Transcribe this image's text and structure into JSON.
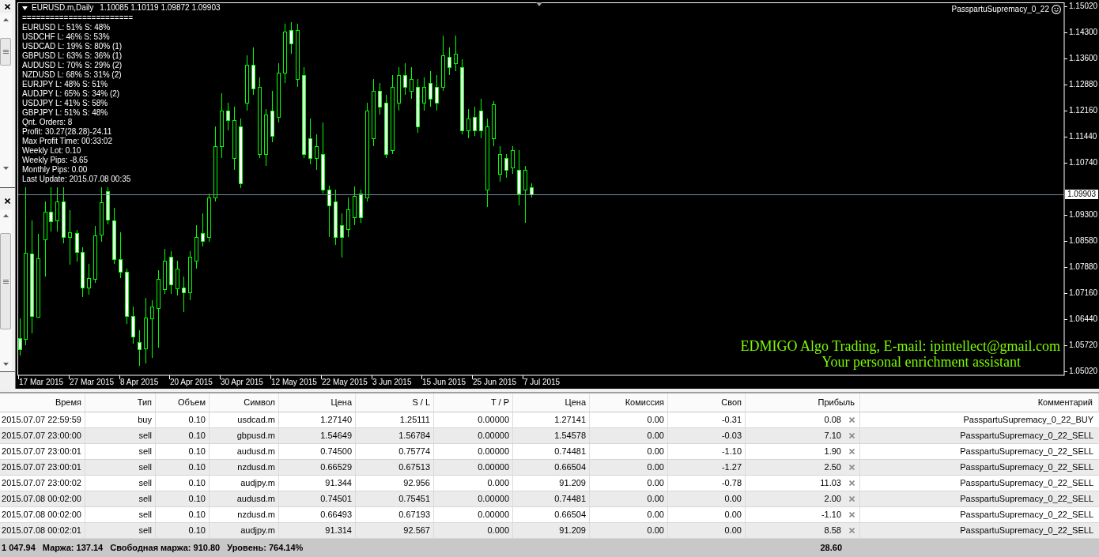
{
  "chart": {
    "title": "EURUSD.m,Daily",
    "ohlc": "1.10085 1.10119 1.09872 1.09903",
    "info_lines": [
      "========================",
      "EURUSD L: 51% S: 48%",
      "USDCHF L: 46% S: 53%",
      "USDCAD L: 19% S: 80% (1)",
      "GBPUSD L: 63% S: 36% (1)",
      "AUDUSD L: 70% S: 29% (2)",
      "NZDUSD L: 68% S: 31% (2)",
      "EURJPY L: 48% S: 51%",
      "AUDJPY L: 65% S: 34% (2)",
      "USDJPY L: 41% S: 58%",
      "GBPJPY L: 51% S: 48%",
      "Qnt. Orders: 8",
      "Profit: 30.27(28.28)-24.11",
      "Max Profit Time: 00:33:02",
      "Weekly Lot: 0.10",
      "Weekly Pips: -8.65",
      "Monthly Pips: 0.00",
      "Last Update: 2015.07.08 00:35"
    ],
    "expert_name": "PasspartuSupremacy_0_22",
    "banner_lines": [
      "EDMIGO Algo Trading, E-mail: ipintellect@gmail.com",
      "Your personal enrichment assistant"
    ],
    "price_labels": [
      "1.15020",
      "1.14300",
      "1.13600",
      "1.12880",
      "1.12160",
      "1.11440",
      "1.10740",
      "1.09300",
      "1.08580",
      "1.07880",
      "1.07160",
      "1.06440",
      "1.05720",
      "1.05020"
    ],
    "current_price": "1.09903",
    "date_labels": [
      "17 Mar 2015",
      "27 Mar 2015",
      "8 Apr 2015",
      "20 Apr 2015",
      "30 Apr 2015",
      "12 May 2015",
      "22 May 2015",
      "3 Jun 2015",
      "15 Jun 2015",
      "25 Jun 2015",
      "7 Jul 2015"
    ]
  },
  "orders_table": {
    "columns": [
      "Время",
      "Тип",
      "Объем",
      "Символ",
      "Цена",
      "S / L",
      "T / P",
      "Цена",
      "Комиссия",
      "Своп",
      "Прибыль",
      "Комментарий"
    ],
    "rows": [
      {
        "selected": false,
        "cells": [
          "2015.07.07 22:59:59",
          "buy",
          "0.10",
          "usdcad.m",
          "1.27140",
          "1.25111",
          "0.00000",
          "1.27141",
          "0.00",
          "-0.31",
          "0.08",
          "PasspartuSupremacy_0_22_BUY"
        ]
      },
      {
        "selected": false,
        "cells": [
          "2015.07.07 23:00:00",
          "sell",
          "0.10",
          "gbpusd.m",
          "1.54649",
          "1.56784",
          "0.00000",
          "1.54578",
          "0.00",
          "-0.03",
          "7.10",
          "PasspartuSupremacy_0_22_SELL"
        ]
      },
      {
        "selected": false,
        "cells": [
          "2015.07.07 23:00:01",
          "sell",
          "0.10",
          "audusd.m",
          "0.74500",
          "0.75774",
          "0.00000",
          "0.74481",
          "0.00",
          "-1.10",
          "1.90",
          "PasspartuSupremacy_0_22_SELL"
        ]
      },
      {
        "selected": false,
        "cells": [
          "2015.07.07 23:00:01",
          "sell",
          "0.10",
          "nzdusd.m",
          "0.66529",
          "0.67513",
          "0.00000",
          "0.66504",
          "0.00",
          "-1.27",
          "2.50",
          "PasspartuSupremacy_0_22_SELL"
        ]
      },
      {
        "selected": false,
        "cells": [
          "2015.07.07 23:00:02",
          "sell",
          "0.10",
          "audjpy.m",
          "91.344",
          "92.956",
          "0.000",
          "91.209",
          "0.00",
          "-0.78",
          "11.03",
          "PasspartuSupremacy_0_22_SELL"
        ]
      },
      {
        "selected": false,
        "cells": [
          "2015.07.08 00:02:00",
          "sell",
          "0.10",
          "audusd.m",
          "0.74501",
          "0.75451",
          "0.00000",
          "0.74481",
          "0.00",
          "0.00",
          "2.00",
          "PasspartuSupremacy_0_22_SELL"
        ]
      },
      {
        "selected": false,
        "cells": [
          "2015.07.08 00:02:00",
          "sell",
          "0.10",
          "nzdusd.m",
          "0.66493",
          "0.67193",
          "0.00000",
          "0.66504",
          "0.00",
          "0.00",
          "-1.10",
          "PasspartuSupremacy_0_22_SELL"
        ]
      },
      {
        "selected": false,
        "cells": [
          "2015.07.08 00:02:01",
          "sell",
          "0.10",
          "audjpy.m",
          "91.314",
          "92.567",
          "0.000",
          "91.209",
          "0.00",
          "0.00",
          "8.58",
          "PasspartuSupremacy_0_22_SELL"
        ]
      }
    ],
    "summary": [
      "1 047.94",
      "Маржа: 137.14",
      "Свободная маржа: 910.80",
      "Уровень: 764.14%"
    ],
    "total_profit": "28.60"
  }
}
